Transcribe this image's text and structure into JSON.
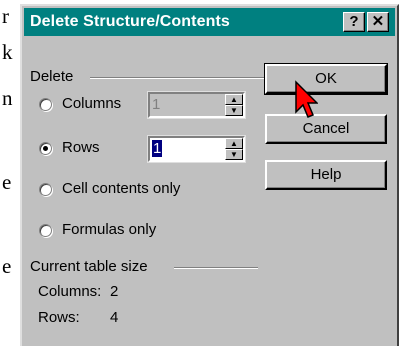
{
  "background_text": [
    "r",
    "k",
    "n",
    "e",
    "e"
  ],
  "dialog": {
    "title": "Delete Structure/Contents",
    "help_button": "?",
    "close_button": "✕",
    "delete_group_label": "Delete",
    "options": {
      "columns": {
        "label": "Columns",
        "value": "1",
        "selected": false
      },
      "rows": {
        "label": "Rows",
        "value": "1",
        "selected": true
      },
      "cell_contents": {
        "label": "Cell contents only",
        "selected": false
      },
      "formulas": {
        "label": "Formulas only",
        "selected": false
      }
    },
    "buttons": {
      "ok": "OK",
      "cancel": "Cancel",
      "help": "Help"
    },
    "table_size": {
      "label": "Current table size",
      "columns_label": "Columns:",
      "columns_value": "2",
      "rows_label": "Rows:",
      "rows_value": "4"
    }
  },
  "colors": {
    "title_bar": "#008080",
    "face": "#c0c0c0",
    "selection": "#000080",
    "cursor": "#ff0000"
  }
}
